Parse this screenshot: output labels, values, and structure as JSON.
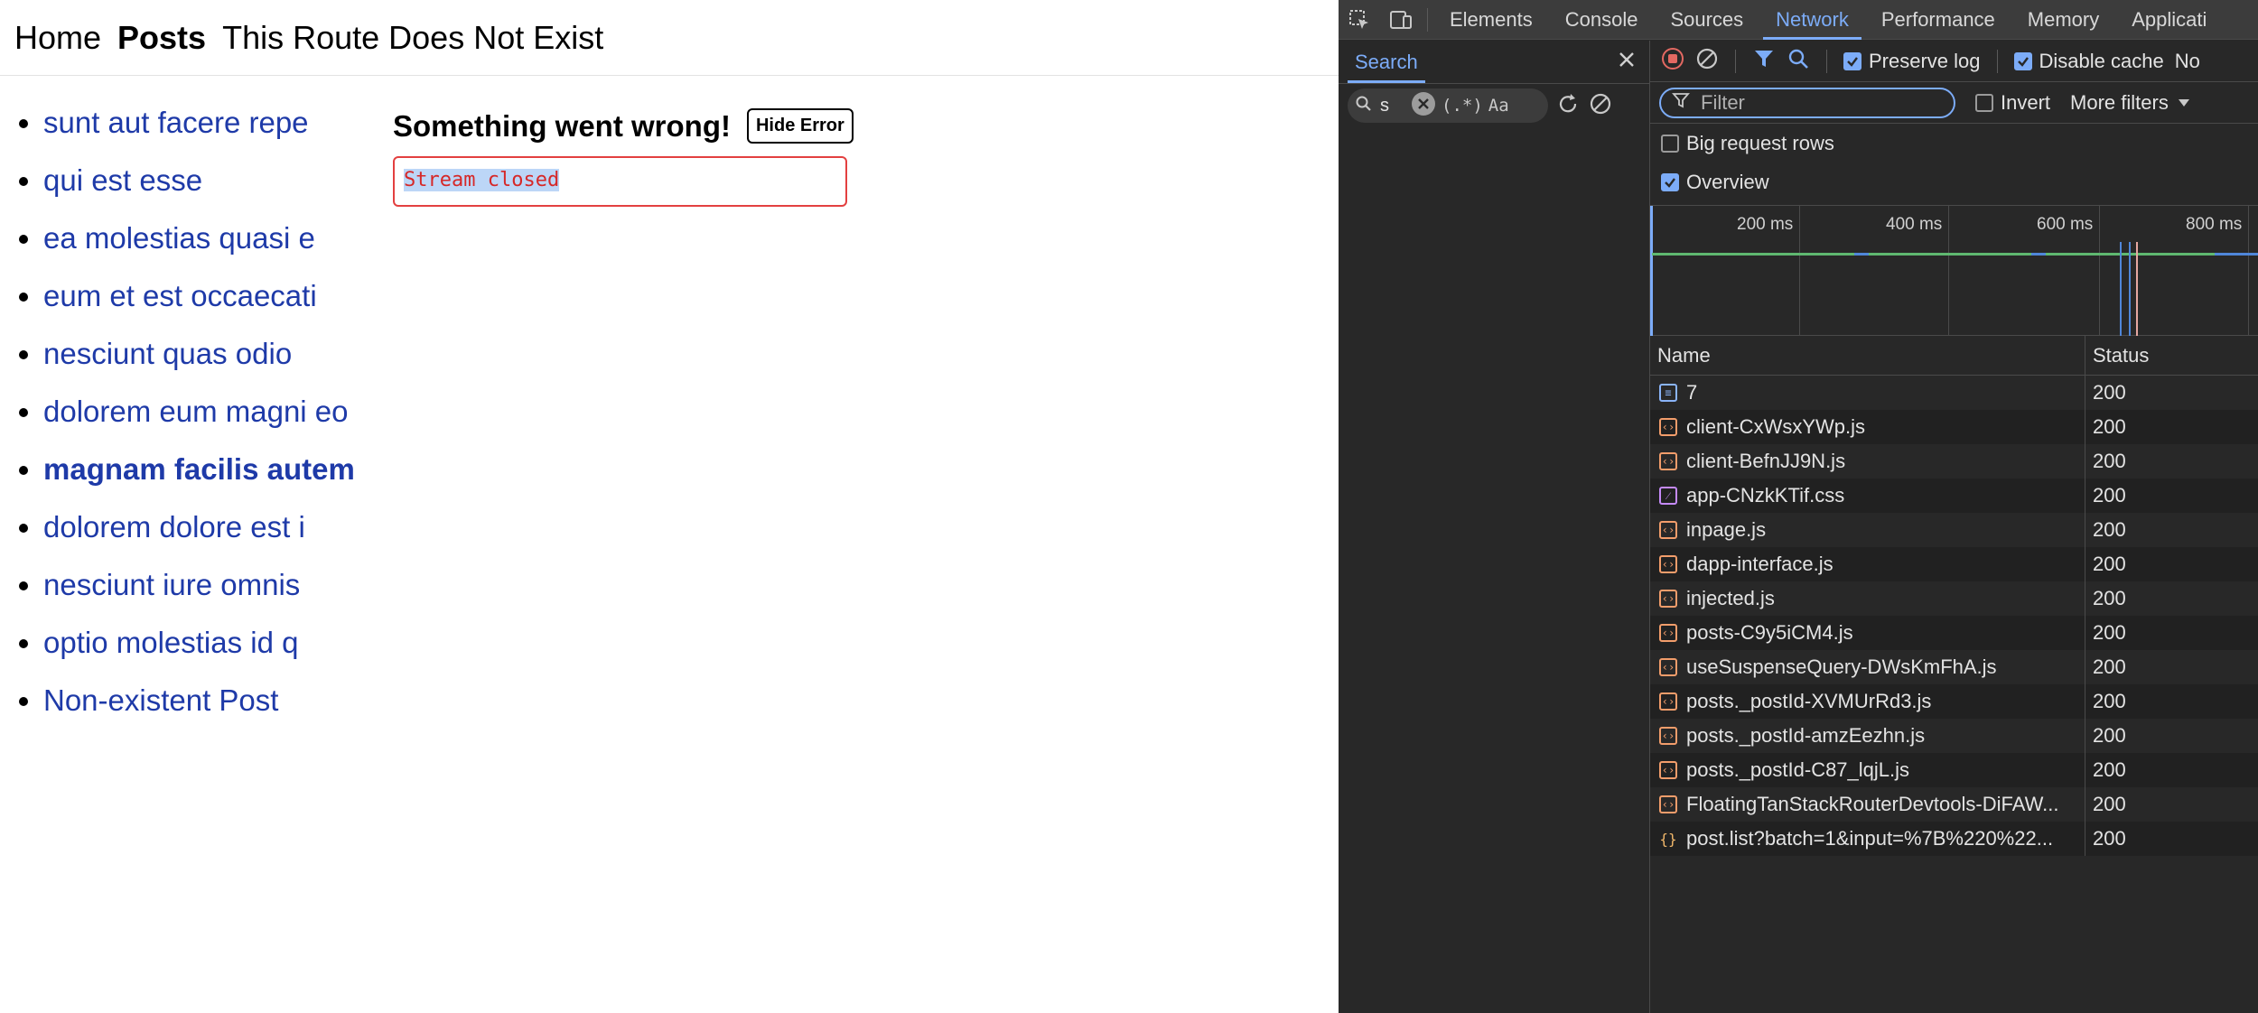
{
  "app": {
    "nav": [
      {
        "label": "Home",
        "active": false
      },
      {
        "label": "Posts",
        "active": true
      },
      {
        "label": "This Route Does Not Exist",
        "active": false
      }
    ],
    "posts": [
      {
        "label": "sunt aut facere repe",
        "active": false
      },
      {
        "label": "qui est esse",
        "active": false
      },
      {
        "label": "ea molestias quasi e",
        "active": false
      },
      {
        "label": "eum et est occaecati",
        "active": false
      },
      {
        "label": "nesciunt quas odio",
        "active": false
      },
      {
        "label": "dolorem eum magni eo",
        "active": false
      },
      {
        "label": "magnam facilis autem",
        "active": true
      },
      {
        "label": "dolorem dolore est i",
        "active": false
      },
      {
        "label": "nesciunt iure omnis",
        "active": false
      },
      {
        "label": "optio molestias id q",
        "active": false
      },
      {
        "label": "Non-existent Post",
        "active": false
      }
    ],
    "error": {
      "title": "Something went wrong!",
      "hide_button": "Hide Error",
      "message": "Stream closed"
    }
  },
  "devtools": {
    "tabs": [
      "Elements",
      "Console",
      "Sources",
      "Network",
      "Performance",
      "Memory",
      "Applicati"
    ],
    "active_tab": "Network",
    "search": {
      "title": "Search",
      "query": "s",
      "regex_label": "(.*)",
      "case_label": "Aa"
    },
    "toolbar": {
      "preserve_log": "Preserve log",
      "disable_cache": "Disable cache",
      "throttle": "No"
    },
    "filter": {
      "placeholder": "Filter",
      "invert": "Invert",
      "more_filters": "More filters"
    },
    "options": {
      "big_rows": "Big request rows",
      "overview": "Overview"
    },
    "timeline_ticks": [
      "200 ms",
      "400 ms",
      "600 ms",
      "800 ms"
    ],
    "columns": {
      "name": "Name",
      "status": "Status"
    },
    "requests": [
      {
        "name": "7",
        "status": "200",
        "type": "doc"
      },
      {
        "name": "client-CxWsxYWp.js",
        "status": "200",
        "type": "js"
      },
      {
        "name": "client-BefnJJ9N.js",
        "status": "200",
        "type": "js"
      },
      {
        "name": "app-CNzkKTif.css",
        "status": "200",
        "type": "css"
      },
      {
        "name": "inpage.js",
        "status": "200",
        "type": "js"
      },
      {
        "name": "dapp-interface.js",
        "status": "200",
        "type": "js"
      },
      {
        "name": "injected.js",
        "status": "200",
        "type": "js"
      },
      {
        "name": "posts-C9y5iCM4.js",
        "status": "200",
        "type": "js"
      },
      {
        "name": "useSuspenseQuery-DWsKmFhA.js",
        "status": "200",
        "type": "js"
      },
      {
        "name": "posts._postId-XVMUrRd3.js",
        "status": "200",
        "type": "js"
      },
      {
        "name": "posts._postId-amzEezhn.js",
        "status": "200",
        "type": "js"
      },
      {
        "name": "posts._postId-C87_lqjL.js",
        "status": "200",
        "type": "js"
      },
      {
        "name": "FloatingTanStackRouterDevtools-DiFAW...",
        "status": "200",
        "type": "js"
      },
      {
        "name": "post.list?batch=1&input=%7B%220%22...",
        "status": "200",
        "type": "fetch"
      }
    ],
    "colors": {
      "accent": "#7cacf8",
      "record": "#e46962"
    }
  }
}
